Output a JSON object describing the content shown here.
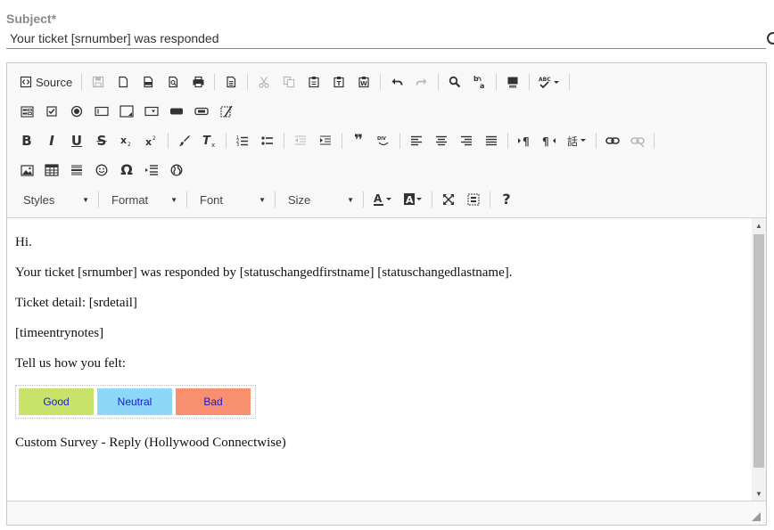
{
  "subject": {
    "label": "Subject*",
    "value": "Your ticket [srnumber] was responded"
  },
  "toolbar": {
    "source_label": "Source",
    "styles_label": "Styles",
    "format_label": "Format",
    "font_label": "Font",
    "size_label": "Size",
    "bold_glyph": "B",
    "italic_glyph": "I",
    "underline_glyph": "U",
    "strike_glyph": "S",
    "quote_glyph": "❞",
    "omega_glyph": "Ω",
    "about_glyph": "?",
    "paragraph_glyph": "¶"
  },
  "content": {
    "lines": [
      "Hi.",
      "Your ticket [srnumber] was responded by [statuschangedfirstname] [statuschangedlastname].",
      "Ticket detail: [srdetail]",
      "[timeentrynotes]",
      "Tell us how you felt:"
    ],
    "survey": [
      {
        "label": "Good",
        "color": "#c9e36a"
      },
      {
        "label": "Neutral",
        "color": "#8dd8f8"
      },
      {
        "label": "Bad",
        "color": "#f88f6f"
      }
    ],
    "footer": "Custom Survey - Reply (Hollywood Connectwise)"
  },
  "colors": {
    "label_gray": "#8a8a8a",
    "link_blue": "#1a1ad6"
  }
}
